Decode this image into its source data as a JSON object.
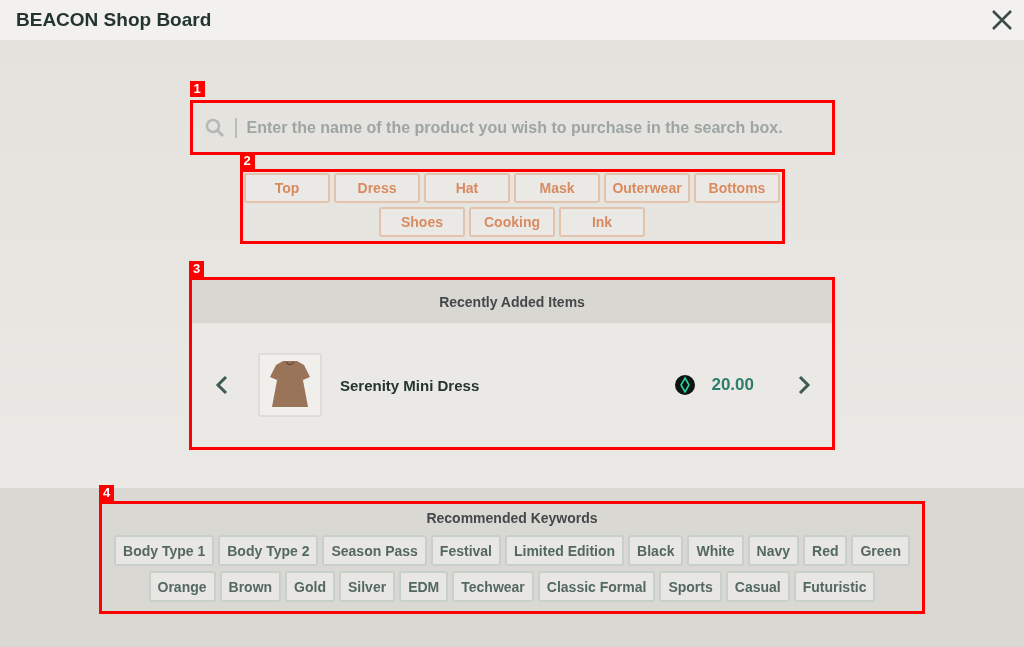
{
  "window": {
    "title": "BEACON Shop Board"
  },
  "search": {
    "callout": "1",
    "placeholder": "Enter the name of the product you wish to purchase in the search box."
  },
  "categories": {
    "callout": "2",
    "items": [
      "Top",
      "Dress",
      "Hat",
      "Mask",
      "Outerwear",
      "Bottoms",
      "Shoes",
      "Cooking",
      "Ink"
    ]
  },
  "recent": {
    "callout": "3",
    "title": "Recently Added Items",
    "item": {
      "name": "Serenity Mini Dress",
      "price": "20.00"
    }
  },
  "keywords": {
    "callout": "4",
    "title": "Recommended Keywords",
    "items": [
      "Body Type 1",
      "Body Type 2",
      "Season Pass",
      "Festival",
      "Limited Edition",
      "Black",
      "White",
      "Navy",
      "Red",
      "Green",
      "Orange",
      "Brown",
      "Gold",
      "Silver",
      "EDM",
      "Techwear",
      "Classic Formal",
      "Sports",
      "Casual",
      "Futuristic"
    ]
  }
}
